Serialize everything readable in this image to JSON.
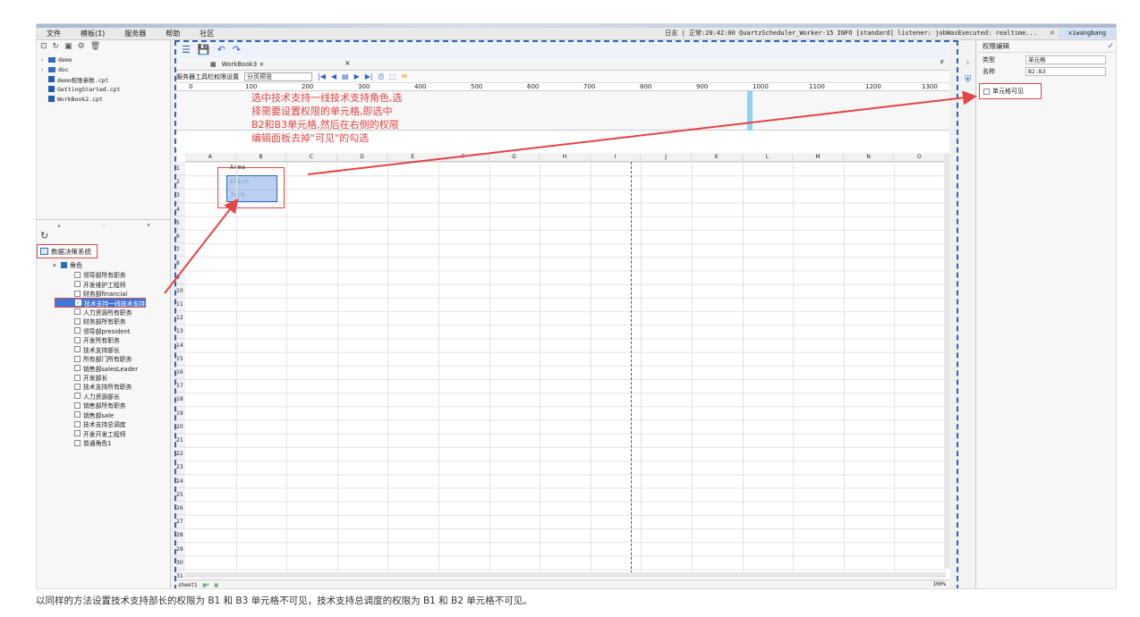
{
  "menu": [
    "文件",
    "模板(Σ)",
    "服务器",
    "帮助",
    "社区"
  ],
  "status_text": "日志 | 正常:20:42:00 QuartzScheduler_Worker-15 INFO [standard] listener: jobWasExecuted: realtime...",
  "user": "xiwangbang",
  "file_tree": [
    {
      "type": "folder",
      "label": "demo"
    },
    {
      "type": "folder",
      "label": "doc"
    },
    {
      "type": "file",
      "label": "demo权限参数.cpt"
    },
    {
      "type": "file",
      "label": "GettingStarted.cpt"
    },
    {
      "type": "file",
      "label": "WorkBook2.cpt"
    }
  ],
  "datasource_title": "数据决策系统",
  "role_root": "角色",
  "roles": [
    "领导部所有职务",
    "开发维护工程师",
    "财务部financial",
    "技术支持一线技术支持",
    "人力资源所有职务",
    "财务部所有职务",
    "领导部president",
    "开发所有职务",
    "技术支持部长",
    "所有部门所有职务",
    "销售部salesLeader",
    "开发部长",
    "技术支持所有职务",
    "人力资源部长",
    "销售部所有职务",
    "销售部sale",
    "技术支持总调度",
    "开发开发工程师",
    "普通角色1"
  ],
  "selected_role_index": 3,
  "tab_label": "WorkBook3 ×",
  "panel_mode_label": "服务器工具栏权限设置",
  "panel_select": "分页预览",
  "ruler_marks": [
    "0",
    "100",
    "200",
    "300",
    "400",
    "500",
    "600",
    "700",
    "800",
    "900",
    "1000",
    "1100",
    "1200",
    "1300"
  ],
  "columns": [
    "A",
    "B",
    "C",
    "D",
    "E",
    "F",
    "G",
    "H",
    "I",
    "J",
    "K",
    "L",
    "M",
    "N",
    "O"
  ],
  "cells": {
    "b1": "Area",
    "b2": "Alice",
    "b3": "Jack"
  },
  "note_lines": [
    "选中技术支持一线技术支持角色,选",
    "择需要设置权限的单元格,即选中",
    "B2和B3单元格,然后在右侧的权限",
    "编辑面板去掉\"可见\"的勾选"
  ],
  "sheet_name": "sheet1",
  "zoom": "100%",
  "right_panel": {
    "title": "权限编辑",
    "type_key": "类型",
    "type_value": "单元格",
    "name_key": "名称",
    "name_value": "B2:B3",
    "visible_label": "单元格可见"
  },
  "caption": "以同样的方法设置技术支持部长的权限为 B1 和 B3 单元格不可见，技术支持总调度的权限为 B1 和 B2 单元格不可见。"
}
